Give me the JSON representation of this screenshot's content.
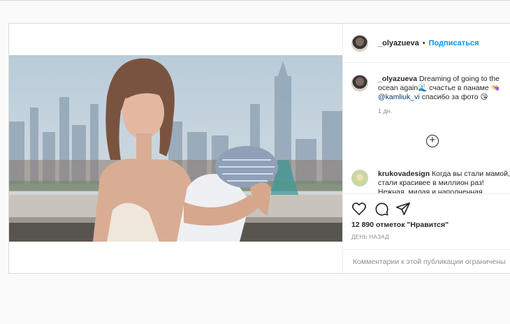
{
  "header": {
    "username": "_olyazueva",
    "separator": "•",
    "follow_label": "Подписаться"
  },
  "caption": {
    "username": "_olyazueva",
    "text_before": "Dreaming of going to the ocean again🌊 счастье в панаме 👒",
    "mention": "@kamliuk_vi",
    "text_after": "спасибо за фото 😘",
    "time": "1 дн."
  },
  "comment": {
    "username": "krukovadesign",
    "text": "Когда вы стали мамой, стали красивее в миллион раз! Нежная, милая и наполненная"
  },
  "load_more_symbol": "+",
  "stats": {
    "likes": "12 890 отметок \"Нравится\"",
    "posted": "ДЕНЬ НАЗАД"
  },
  "footer": {
    "comments_limited": "Комментарии к этой публикации ограничены"
  },
  "icons": [
    "heart-icon",
    "comment-icon",
    "share-icon",
    "bookmark-icon",
    "add-circle-icon"
  ]
}
